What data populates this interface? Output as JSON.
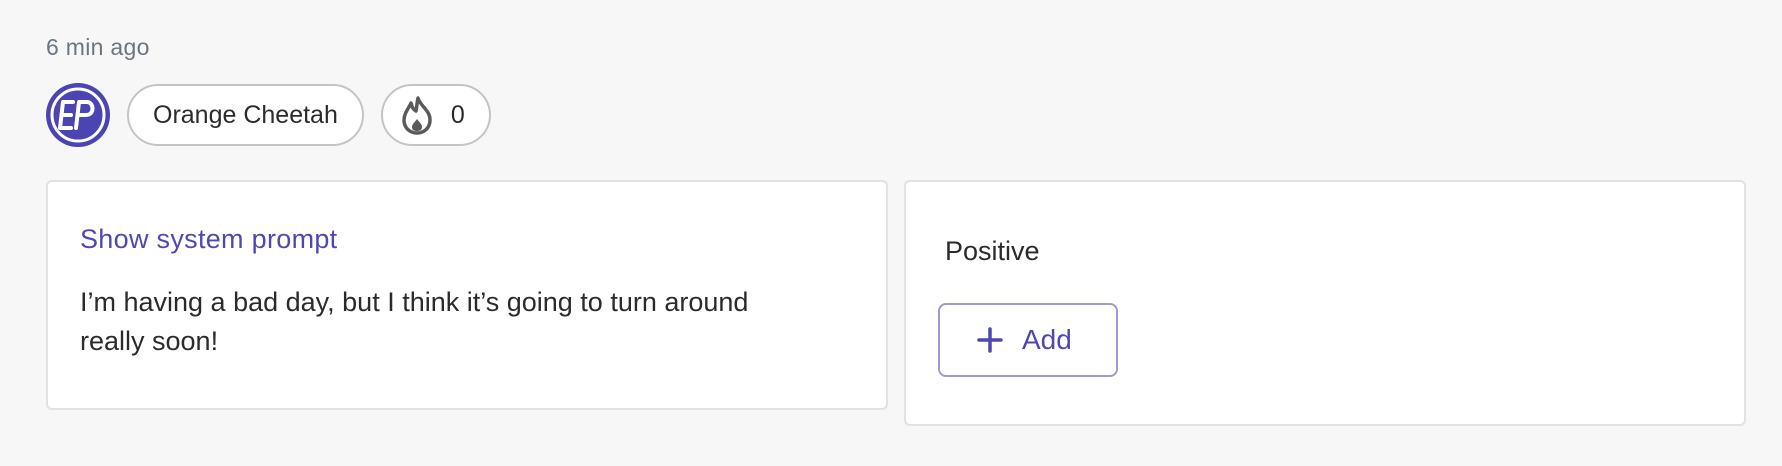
{
  "post": {
    "timestamp": "6 min ago",
    "author_name": "Orange Cheetah",
    "score": "0"
  },
  "prompt_card": {
    "show_prompt_label": "Show system prompt",
    "message": "I’m having a bad day, but I think it’s going to turn around really soon!"
  },
  "label_card": {
    "label": "Positive",
    "add_label": "Add"
  },
  "icons": {
    "avatar": "avatar-logo-icon",
    "score": "flame-icon",
    "add": "plus-icon"
  },
  "colors": {
    "accent": "#4f48b0",
    "avatar_bg": "#4b45b3",
    "background": "#f7f7f7"
  }
}
